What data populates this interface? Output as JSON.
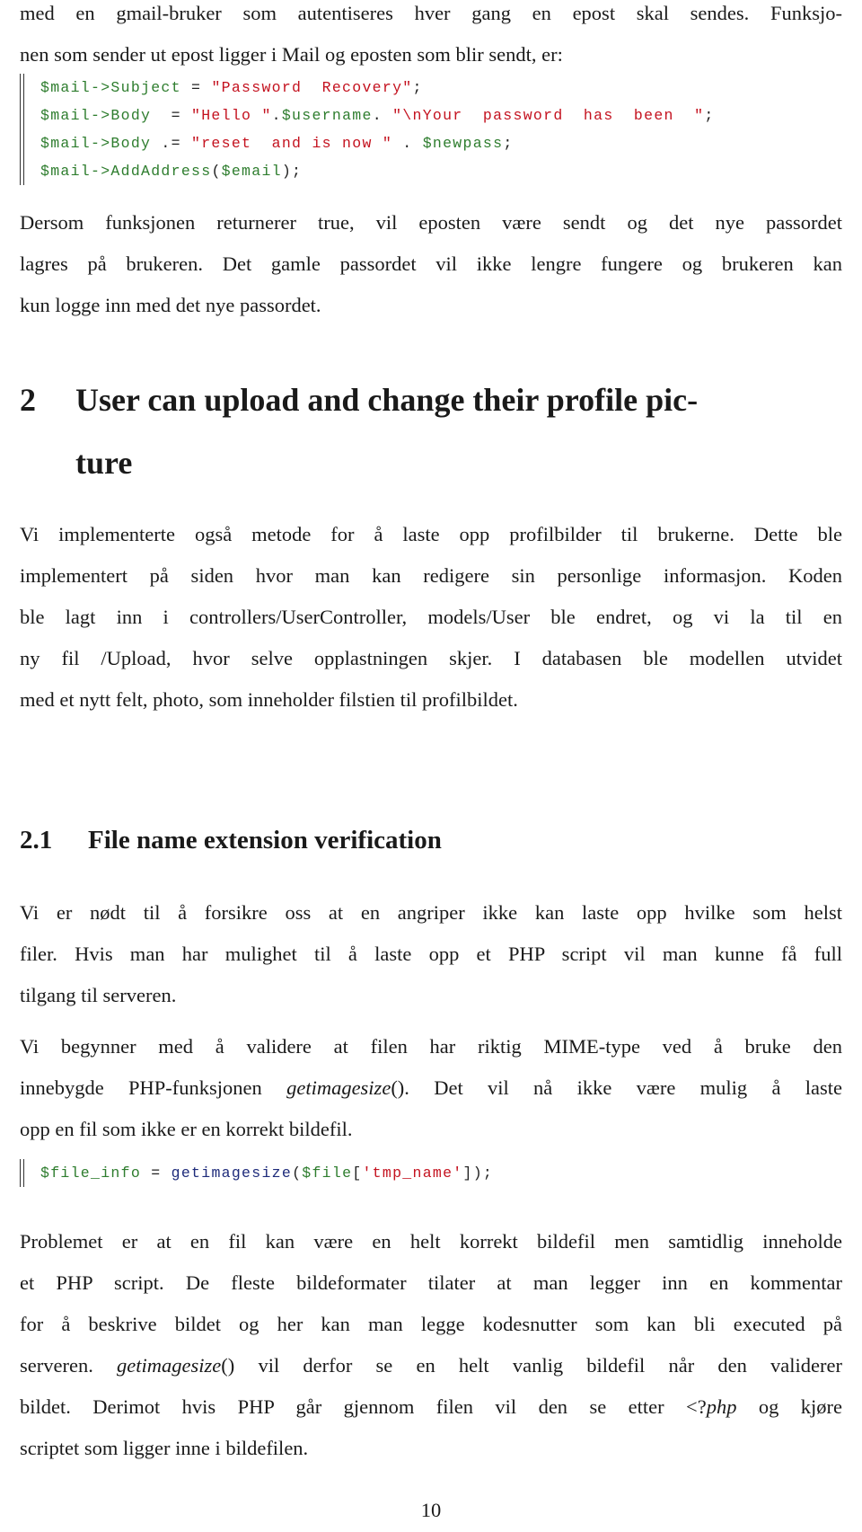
{
  "intro": {
    "line1": "med en gmail-bruker som autentiseres hver gang en epost skal sendes. Funksjo-",
    "line2": "nen som sender ut epost ligger i Mail og eposten som blir sendt, er:"
  },
  "code1": {
    "lines": [
      [
        {
          "t": "$mail->Subject",
          "c": "g"
        },
        {
          "t": " = ",
          "c": "k"
        },
        {
          "t": "\"Password  Recovery\"",
          "c": "r"
        },
        {
          "t": ";",
          "c": "k"
        }
      ],
      [
        {
          "t": "$mail->Body",
          "c": "g"
        },
        {
          "t": "  = ",
          "c": "k"
        },
        {
          "t": "\"Hello \"",
          "c": "r"
        },
        {
          "t": ".",
          "c": "k"
        },
        {
          "t": "$username",
          "c": "g"
        },
        {
          "t": ". ",
          "c": "k"
        },
        {
          "t": "\"\\nYour  password  has  been  \"",
          "c": "r"
        },
        {
          "t": ";",
          "c": "k"
        }
      ],
      [
        {
          "t": "$mail->Body",
          "c": "g"
        },
        {
          "t": " .= ",
          "c": "k"
        },
        {
          "t": "\"reset  and is now \"",
          "c": "r"
        },
        {
          "t": " . ",
          "c": "k"
        },
        {
          "t": "$newpass",
          "c": "g"
        },
        {
          "t": ";",
          "c": "k"
        }
      ],
      [
        {
          "t": "$mail->AddAddress",
          "c": "g"
        },
        {
          "t": "(",
          "c": "k"
        },
        {
          "t": "$email",
          "c": "g"
        },
        {
          "t": ");",
          "c": "k"
        }
      ]
    ]
  },
  "para_after_code1": {
    "line1": "Dersom funksjonen returnerer true, vil eposten være sendt og det nye passordet",
    "line2": "lagres på brukeren. Det gamle passordet vil ikke lengre fungere og brukeren kan",
    "line3": "kun logge inn med det nye passordet."
  },
  "section2": {
    "number": "2",
    "title_line1": "User can upload and change their profile pic-",
    "title_line2": "ture",
    "para": {
      "line1": "Vi implementerte også metode for å laste opp profilbilder til brukerne. Dette ble",
      "line2": "implementert på siden hvor man kan redigere sin personlige informasjon. Koden",
      "line3": "ble lagt inn i controllers/UserController, models/User ble endret, og vi la til en",
      "line4": "ny fil /Upload, hvor selve opplastningen skjer. I databasen ble modellen utvidet",
      "line5": "med et nytt felt, photo, som inneholder filstien til profilbildet."
    }
  },
  "section2_1": {
    "number": "2.1",
    "title": "File name extension verification",
    "para1": {
      "line1": "Vi er nødt til å forsikre oss at en angriper ikke kan laste opp hvilke som helst",
      "line2": "filer. Hvis man har mulighet til å laste opp et PHP script vil man kunne få full",
      "line3": "tilgang til serveren."
    },
    "para2": {
      "line1": "Vi begynner med å validere at filen har riktig MIME-type ved å bruke den",
      "line2_pre": "innebygde PHP-funksjonen ",
      "line2_italic": "getimagesize",
      "line2_post": "(). Det vil nå ikke være mulig å laste",
      "line3": "opp en fil som ikke er en korrekt bildefil."
    },
    "code2": {
      "lines": [
        [
          {
            "t": "$file_info",
            "c": "g"
          },
          {
            "t": " = ",
            "c": "k"
          },
          {
            "t": "getimagesize",
            "c": "b"
          },
          {
            "t": "(",
            "c": "k"
          },
          {
            "t": "$file",
            "c": "g"
          },
          {
            "t": "[",
            "c": "k"
          },
          {
            "t": "'tmp_name'",
            "c": "r"
          },
          {
            "t": "]);",
            "c": "k"
          }
        ]
      ]
    },
    "para3": {
      "line1": "Problemet er at en fil kan være en helt korrekt bildefil men samtidlig inneholde",
      "line2": "et PHP script. De fleste bildeformater tilater at man legger inn en kommentar",
      "line3": "for å beskrive bildet og her kan man legge kodesnutter som kan bli executed på",
      "line4_pre": "serveren. ",
      "line4_italic": "getimagesize",
      "line4_post": "() vil derfor se en helt vanlig bildefil når den validerer",
      "line5_pre": "bildet. Derimot hvis PHP går gjennom filen vil den se etter <?",
      "line5_italic": "php",
      "line5_post": " og kjøre",
      "line6": "scriptet som ligger inne i bildefilen."
    }
  },
  "page_number": "10"
}
